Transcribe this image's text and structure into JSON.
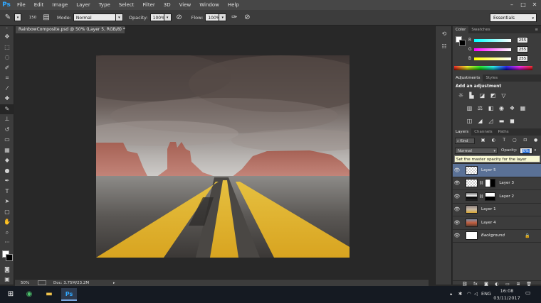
{
  "app": {
    "logo": "Ps"
  },
  "menu": [
    "File",
    "Edit",
    "Image",
    "Layer",
    "Type",
    "Select",
    "Filter",
    "3D",
    "View",
    "Window",
    "Help"
  ],
  "window_controls": [
    "–",
    "□",
    "✕"
  ],
  "options_bar": {
    "brush_size": "150",
    "mode_label": "Mode:",
    "mode_value": "Normal",
    "opacity_label": "Opacity:",
    "opacity_value": "100%",
    "flow_label": "Flow:",
    "flow_value": "100%",
    "workspace": "Essentials"
  },
  "document": {
    "tab_title": "RainbowComposite.psd @ 50% (Layer 5, RGB/8) *",
    "zoom": "50%",
    "doc_info": "Doc: 3.75M/23.2M"
  },
  "color_panel": {
    "tabs": [
      "Color",
      "Swatches"
    ],
    "channels": [
      {
        "label": "R",
        "value": "255"
      },
      {
        "label": "G",
        "value": "255"
      },
      {
        "label": "B",
        "value": "255"
      }
    ]
  },
  "adjustments_panel": {
    "tabs": [
      "Adjustments",
      "Styles"
    ],
    "heading": "Add an adjustment"
  },
  "layers_panel": {
    "tabs": [
      "Layers",
      "Channels",
      "Paths"
    ],
    "filter_label": "Kind",
    "blend_mode": "Normal",
    "opacity_label": "Opacity:",
    "opacity_value": "0%",
    "lock_prefix": "Lo",
    "tooltip": "Set the master opacity for the layer",
    "layers": [
      {
        "name": "Layer 5",
        "selected": true
      },
      {
        "name": "Layer 3",
        "selected": false
      },
      {
        "name": "Layer 2",
        "selected": false
      },
      {
        "name": "Layer 1",
        "selected": false
      },
      {
        "name": "Layer 4",
        "selected": false
      },
      {
        "name": "Background",
        "selected": false
      }
    ]
  },
  "taskbar": {
    "language": "ENG",
    "time": "16:08",
    "date": "03/11/2017"
  },
  "colors": {
    "accent": "#31a8ff",
    "selected_layer": "#5a7196",
    "road_yellow": "#e3b62b",
    "rock_red": "#b46a5c"
  }
}
